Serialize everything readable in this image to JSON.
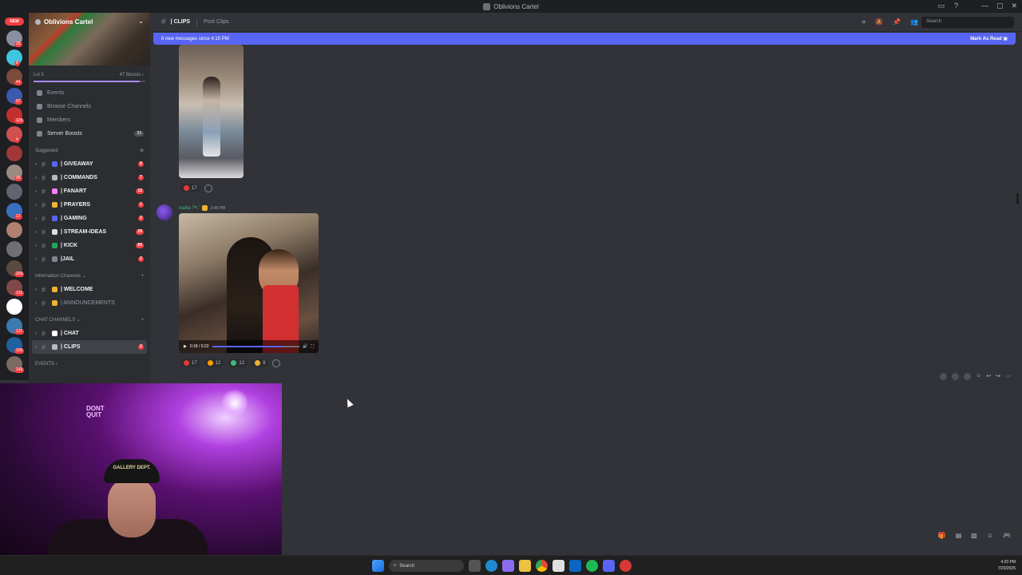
{
  "window": {
    "title": "Oblivions Cartel"
  },
  "server": {
    "name": "Oblivions Cartel",
    "level": "Lvl 3",
    "boosts": "47 Boosts",
    "boost_progress": 0.95
  },
  "rail": {
    "new_label": "NEW",
    "badges": [
      "25",
      "8",
      "44",
      "97",
      "129",
      "4",
      "",
      "90",
      "",
      "17",
      "",
      "",
      "209",
      "132",
      "",
      "137",
      "109",
      "148"
    ]
  },
  "nav": [
    {
      "label": "Events",
      "count": ""
    },
    {
      "label": "Browse Channels",
      "count": ""
    },
    {
      "label": "Members",
      "count": ""
    },
    {
      "label": "Server Boosts",
      "count": "33"
    }
  ],
  "categories": {
    "suggested": "Suggested",
    "info": "Information Channels",
    "chat": "CHAT CHANNELS",
    "events": "EVENTS"
  },
  "suggested_channels": [
    {
      "name": "| GIVEAWAY",
      "count": "6",
      "color": "#5865f2"
    },
    {
      "name": "| COMMANDS",
      "count": "7",
      "color": "#b5bac1"
    },
    {
      "name": "| FANART",
      "count": "12",
      "color": "#f47fff"
    },
    {
      "name": "| PRAYERS",
      "count": "1",
      "color": "#f0b232"
    },
    {
      "name": "| GAMING",
      "count": "3",
      "color": "#5865f2"
    },
    {
      "name": "| STREAM-IDEAS",
      "count": "29",
      "color": "#dbdee1"
    },
    {
      "name": "| KICK",
      "count": "60",
      "color": "#23a55a"
    },
    {
      "name": "|JAIL",
      "count": "2",
      "color": "#80848e"
    }
  ],
  "info_channels": [
    {
      "name": "| WELCOME",
      "muted": false,
      "color": "#f0b232"
    },
    {
      "name": "| ANNOUNCEMENTS",
      "muted": true,
      "color": "#f0b232"
    }
  ],
  "chat_channels": [
    {
      "name": "| CHAT",
      "count": "",
      "active": false,
      "color": "#ffffff"
    },
    {
      "name": "| CLIPS",
      "count": "2",
      "active": true,
      "color": "#b5bac1"
    }
  ],
  "header": {
    "channel": "| CLIPS",
    "topic": "Post Clips",
    "search_placeholder": "Search"
  },
  "new_messages": {
    "text": "6 new messages since 4:10 PM",
    "action": "Mark As Read"
  },
  "messages": [
    {
      "reactions": [
        {
          "count": "17",
          "color": "#e53935"
        }
      ]
    },
    {
      "author": "nadia ?٩ ̃",
      "time": "3:48 PM",
      "video": {
        "time": "0:18 / 0:22",
        "progress": 0.82
      },
      "reactions": [
        {
          "count": "17",
          "color": "#e53935"
        },
        {
          "count": "12",
          "color": "#ff9800"
        },
        {
          "count": "12",
          "color": "#43b581"
        },
        {
          "count": "9",
          "color": "#f0b232"
        }
      ]
    }
  ],
  "webcam": {
    "hat_text": "GALLERY DEPT.",
    "neon_text": "DONT QUIT"
  },
  "taskbar": {
    "search": "Search",
    "time": "4:20 PM",
    "date": "7/20/2025"
  }
}
